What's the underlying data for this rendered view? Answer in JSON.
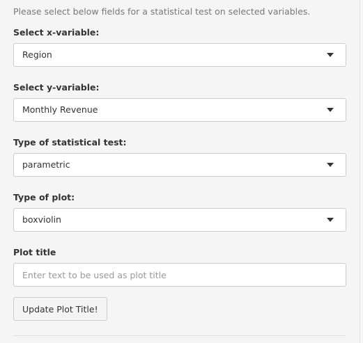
{
  "intro_text": "Please select below fields for a statistical test on selected variables.",
  "x_variable": {
    "label": "Select x-variable:",
    "value": "Region"
  },
  "y_variable": {
    "label": "Select y-variable:",
    "value": "Monthly Revenue"
  },
  "test_type": {
    "label": "Type of statistical test:",
    "value": "parametric"
  },
  "plot_type": {
    "label": "Type of plot:",
    "value": "boxviolin"
  },
  "plot_title": {
    "label": "Plot title",
    "placeholder": "Enter text to be used as plot title",
    "value": ""
  },
  "update_button": {
    "label": "Update Plot Title!"
  }
}
